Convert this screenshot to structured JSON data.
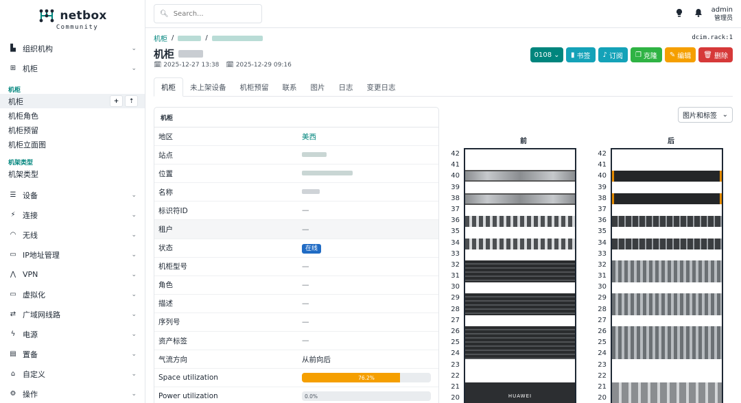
{
  "app": {
    "logo_name": "netbox",
    "logo_sub": "Community"
  },
  "sidebar": {
    "groups_top": [
      {
        "label": "组织机构",
        "icon": "building-icon"
      },
      {
        "label": "机柜",
        "icon": "rack-grid-icon"
      }
    ],
    "section_rack": "机柜",
    "rack_items": [
      "机柜",
      "机柜角色",
      "机柜预留",
      "机柜立面图"
    ],
    "section_type": "机架类型",
    "type_items": [
      "机架类型"
    ],
    "groups_bottom": [
      {
        "label": "设备",
        "icon": "server-icon"
      },
      {
        "label": "连接",
        "icon": "plug-icon"
      },
      {
        "label": "无线",
        "icon": "wifi-icon"
      },
      {
        "label": "IP地址管理",
        "icon": "ip-icon"
      },
      {
        "label": "VPN",
        "icon": "vpn-icon"
      },
      {
        "label": "虚拟化",
        "icon": "monitor-icon"
      },
      {
        "label": "广域网线路",
        "icon": "circuit-icon"
      },
      {
        "label": "电源",
        "icon": "power-icon"
      },
      {
        "label": "置备",
        "icon": "provisioning-icon"
      },
      {
        "label": "自定义",
        "icon": "customize-icon"
      },
      {
        "label": "操作",
        "icon": "operations-icon"
      }
    ],
    "add_btn": "+",
    "import_btn": "⇡"
  },
  "header": {
    "search_placeholder": "Search...",
    "user_name": "admin",
    "user_role": "管理员"
  },
  "page": {
    "breadcrumb_root": "机柜",
    "object_id": "dcim.rack:1",
    "title": "机柜",
    "created": "2025-12-27 13:38",
    "updated": "2025-12-29 09:16",
    "actions": {
      "tenant_btn": "0108",
      "bookmark": "书签",
      "subscribe": "订阅",
      "clone": "克隆",
      "edit": "编辑",
      "delete": "删除"
    },
    "tabs": [
      "机柜",
      "未上架设备",
      "机柜预留",
      "联系",
      "图片",
      "日志",
      "变更日志"
    ]
  },
  "card": {
    "title": "机柜",
    "rows": [
      {
        "key": "地区",
        "value": "美西",
        "type": "link"
      },
      {
        "key": "站点",
        "value": "",
        "type": "blur"
      },
      {
        "key": "位置",
        "value": "",
        "type": "blur"
      },
      {
        "key": "名称",
        "value": "",
        "type": "blur"
      },
      {
        "key": "标识符ID",
        "value": "—",
        "type": "dash"
      },
      {
        "key": "租户",
        "value": "—",
        "type": "dash"
      },
      {
        "key": "状态",
        "value": "在线",
        "type": "badge"
      },
      {
        "key": "机柜型号",
        "value": "—",
        "type": "dash"
      },
      {
        "key": "角色",
        "value": "—",
        "type": "dash"
      },
      {
        "key": "描述",
        "value": "—",
        "type": "dash"
      },
      {
        "key": "序列号",
        "value": "—",
        "type": "dash"
      },
      {
        "key": "资产标签",
        "value": "—",
        "type": "dash"
      },
      {
        "key": "气流方向",
        "value": "从前向后",
        "type": "text"
      },
      {
        "key": "Space utilization",
        "value": "76.2%",
        "type": "progress",
        "pct": 76.2
      },
      {
        "key": "Power utilization",
        "value": "0.0%",
        "type": "progress",
        "pct": 0
      }
    ]
  },
  "rack_view": {
    "select_label": "图片和标签",
    "front_label": "前",
    "rear_label": "后",
    "unit_numbers": [
      42,
      41,
      40,
      39,
      38,
      37,
      36,
      35,
      34,
      33,
      32,
      31,
      30,
      29,
      28,
      27,
      26,
      25,
      24,
      23,
      22,
      21,
      20
    ],
    "front_brand": "HUAWEI",
    "colors": {
      "accent": "#00857d",
      "rack_border": "#1d2733"
    }
  }
}
